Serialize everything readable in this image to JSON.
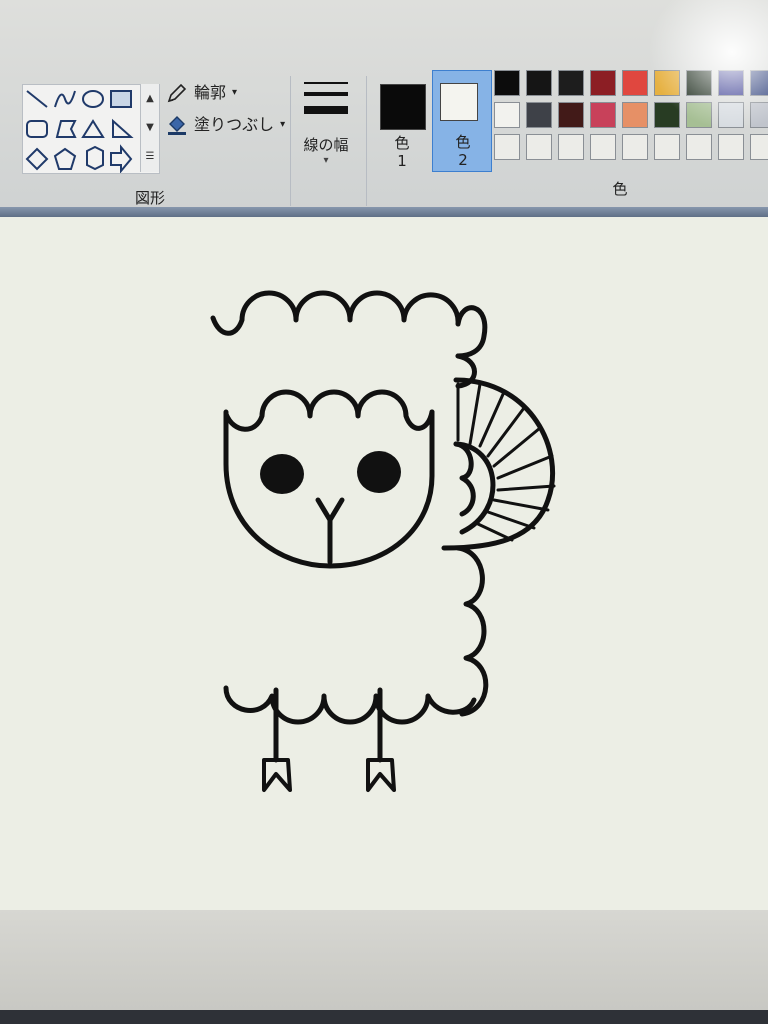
{
  "ribbon": {
    "shapes_group_label": "図形",
    "outline_label": "輪郭",
    "fill_label": "塗りつぶし",
    "line_width_label": "線の幅",
    "color_group_label": "色",
    "color1_label_top": "色",
    "color1_label_num": "1",
    "color2_label_top": "色",
    "color2_label_num": "2",
    "colors": {
      "color1": "#0a0a0a",
      "color2": "#f4f4ef",
      "selected_bg": "#86b3e6",
      "selected_border": "#3d7fcf"
    }
  },
  "shapes": [
    "line-shape-icon",
    "curve-shape-icon",
    "oval-shape-icon",
    "rectangle-shape-icon",
    "rounded-rectangle-shape-icon",
    "polygon-shape-icon",
    "triangle-shape-icon",
    "right-triangle-shape-icon",
    "diamond-shape-icon",
    "pentagon-shape-icon",
    "hexagon-shape-icon",
    "right-arrow-shape-icon"
  ],
  "palette": [
    [
      "#0c0c0c",
      "#151515",
      "#1d1d1d",
      "#8c1e24",
      "#e0473f",
      "#e6b142",
      "#1b2a1b",
      "#2b2e8a",
      "#2c3e7a"
    ],
    [
      "#f2f2ee",
      "#3e4148",
      "#421a18",
      "#c8415a",
      "#e69066",
      "#283c23",
      "#a6bf94",
      "#d6dbe0",
      "#c0c4cc"
    ],
    [
      "#ecece8",
      "#ecece8",
      "#ecece8",
      "#ecece8",
      "#ecece8",
      "#ecece8",
      "#ecece8",
      "#ecece8",
      "#ecece8"
    ]
  ],
  "drawing": {
    "subject": "sheep-drawing",
    "stroke_color": "#111111",
    "canvas_color": "#eceee5"
  }
}
